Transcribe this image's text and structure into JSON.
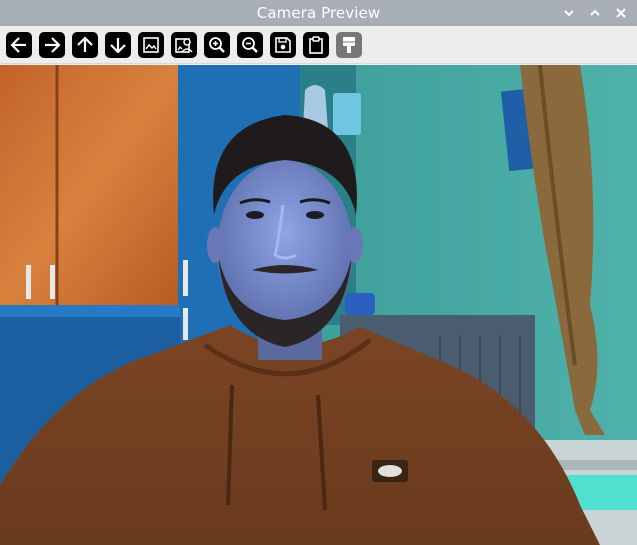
{
  "window": {
    "title": "Camera Preview",
    "controls": [
      {
        "name": "minimize-button",
        "icon": "chevron-down-icon"
      },
      {
        "name": "maximize-button",
        "icon": "chevron-up-icon"
      },
      {
        "name": "close-button",
        "icon": "close-icon"
      }
    ]
  },
  "toolbar": {
    "buttons": [
      {
        "name": "back-button",
        "icon": "arrow-left-icon",
        "enabled": true
      },
      {
        "name": "forward-button",
        "icon": "arrow-right-icon",
        "enabled": true
      },
      {
        "name": "up-button",
        "icon": "arrow-up-icon",
        "enabled": true
      },
      {
        "name": "down-button",
        "icon": "arrow-down-icon",
        "enabled": true
      },
      {
        "name": "image-button",
        "icon": "image-icon",
        "enabled": true
      },
      {
        "name": "image-person-button",
        "icon": "image-person-icon",
        "enabled": true
      },
      {
        "name": "zoom-in-button",
        "icon": "zoom-in-icon",
        "enabled": true
      },
      {
        "name": "zoom-out-button",
        "icon": "zoom-out-icon",
        "enabled": true
      },
      {
        "name": "save-button",
        "icon": "save-icon",
        "enabled": true
      },
      {
        "name": "clipboard-button",
        "icon": "clipboard-icon",
        "enabled": true
      },
      {
        "name": "brush-button",
        "icon": "paint-brush-icon",
        "enabled": false
      }
    ]
  },
  "colors": {
    "titlebar": "#a7aeb6",
    "toolbar": "#ededed",
    "button": "#000000",
    "button_disabled": "#777777"
  }
}
